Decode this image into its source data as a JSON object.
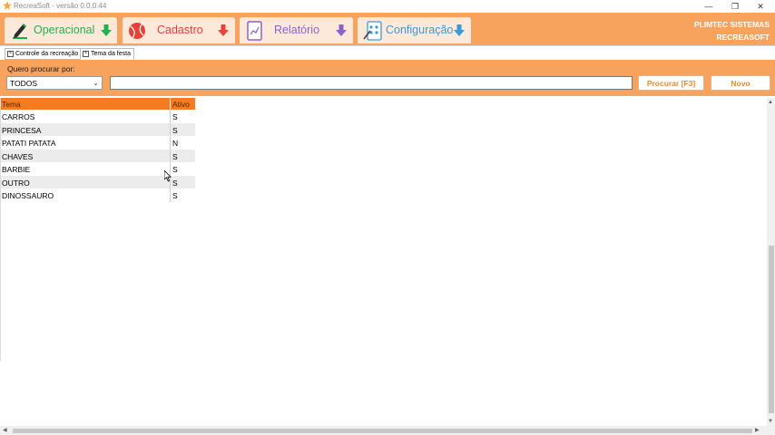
{
  "window": {
    "title": "RecreaSoft  -  versão 0.0.0.44",
    "minimize_glyph": "—",
    "maximize_glyph": "❐",
    "close_glyph": "✕"
  },
  "ribbon": {
    "company_line1": "PLIMTEC SISTEMAS",
    "company_line2": "RECREASOFT",
    "menus": [
      {
        "label": "Operacional",
        "icon": "pencil-icon",
        "color": "#22b14c"
      },
      {
        "label": "Cadastro",
        "icon": "ball-icon",
        "color": "#e8413a"
      },
      {
        "label": "Relatório",
        "icon": "report-icon",
        "color": "#8e63c8"
      },
      {
        "label": "Configuração",
        "icon": "settings-icon",
        "color": "#3a9ad9"
      }
    ]
  },
  "tabs": [
    {
      "label": "Controle da recreação",
      "active": false
    },
    {
      "label": "Tema da festa",
      "active": true
    }
  ],
  "search": {
    "label": "Quero procurar por:",
    "selected_option": "TODOS",
    "input_value": "",
    "search_button": "Procurar [F3]",
    "new_button": "Novo"
  },
  "grid": {
    "headers": {
      "tema": "Tema",
      "ativo": "Ativo"
    },
    "rows": [
      {
        "tema": "CARROS",
        "ativo": "S"
      },
      {
        "tema": "PRINCESA",
        "ativo": "S"
      },
      {
        "tema": "PATATI PATATA",
        "ativo": "N"
      },
      {
        "tema": "CHAVES",
        "ativo": "S"
      },
      {
        "tema": "BARBIE",
        "ativo": "S"
      },
      {
        "tema": "OUTRO",
        "ativo": "S"
      },
      {
        "tema": "DINOSSAURO",
        "ativo": "S"
      }
    ]
  },
  "colors": {
    "ribbon_orange": "#f7a35d",
    "header_orange": "#f47b1f",
    "button_text": "#f08a2e"
  }
}
